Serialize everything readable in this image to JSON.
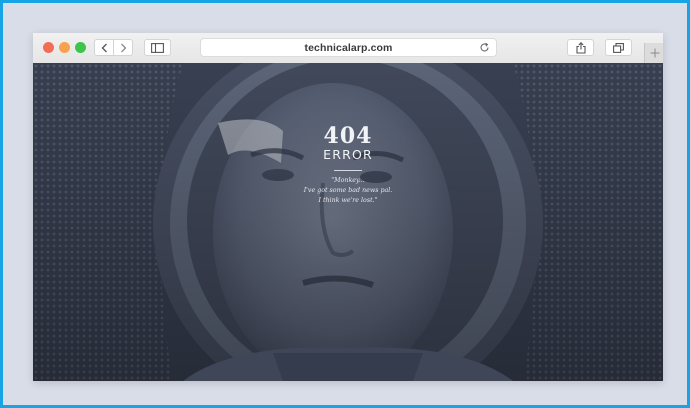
{
  "browser": {
    "url": "technicalarp.com",
    "icons": {
      "back": "chevron-left-icon",
      "forward": "chevron-right-icon",
      "sidebar": "sidebar-icon",
      "reload": "reload-icon",
      "share": "share-icon",
      "tabs": "tabs-icon",
      "new_tab": "plus-icon"
    }
  },
  "page": {
    "code": "404",
    "title": "ERROR",
    "quote_lines": [
      "\"Monkey...",
      "I've got some bad news pal.",
      "I think we're lost.\""
    ]
  },
  "colors": {
    "frame_border": "#17a4e4",
    "frame_background": "#d9dde8",
    "page_background": "#3e4659",
    "traffic_red": "#f26d56",
    "traffic_yellow": "#f6a34f",
    "traffic_green": "#3ec34c"
  }
}
